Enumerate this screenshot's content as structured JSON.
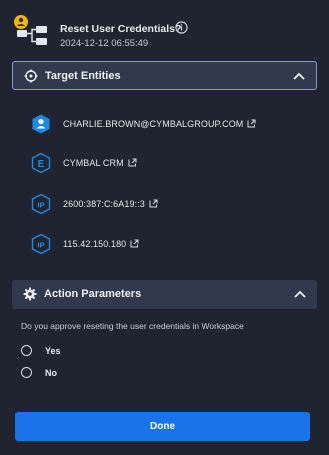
{
  "header": {
    "title": "Reset User Credentials?",
    "timestamp": "2024-12-12 06:55:49",
    "icon": "workflow-user-icon",
    "info_icon": "info-icon"
  },
  "targets": {
    "label": "Target Entities",
    "icon": "crosshair-icon",
    "expanded": true,
    "items": [
      {
        "label": "CHARLIE.BROWN@CYMBALGROUP.COM",
        "icon": "user-shield-icon"
      },
      {
        "label": "CYMBAL CRM",
        "icon": "application-e-icon"
      },
      {
        "label": "2600:387:C:6A19::3",
        "icon": "ip-address-icon"
      },
      {
        "label": "115.42.150.180",
        "icon": "ip-address-icon"
      }
    ]
  },
  "parameters": {
    "label": "Action Parameters",
    "icon": "gear-icon",
    "expanded": true,
    "question": "Do you approve reseting the user credentials in Workspace",
    "options": [
      "Yes",
      "No"
    ]
  },
  "actions": {
    "done_label": "Done"
  },
  "colors": {
    "background": "#1f2430",
    "section_header": "#313a4c",
    "accent_button": "#1a73e8",
    "entity_icon": "#1e88e5",
    "selected_border": "#8b9ad0"
  }
}
